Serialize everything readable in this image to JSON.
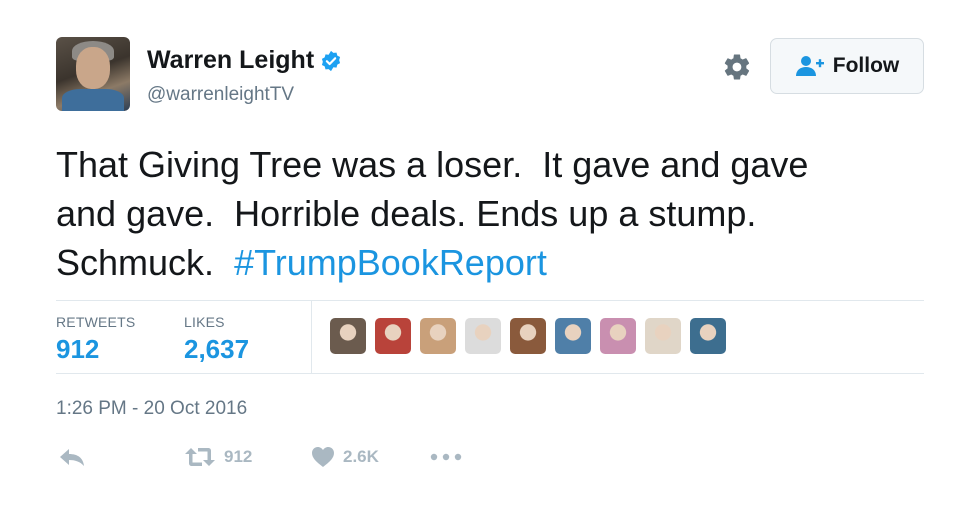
{
  "user": {
    "name": "Warren Leight",
    "handle": "@warrenleightTV",
    "verified": true
  },
  "follow_button": {
    "label": "Follow"
  },
  "tweet": {
    "lines": [
      "That Giving Tree was a loser.  It gave and gave",
      "and gave.  Horrible deals. Ends up a stump.",
      "Schmuck.  "
    ],
    "hashtag": "#TrumpBookReport"
  },
  "stats": {
    "retweets_label": "RETWEETS",
    "retweets_value": "912",
    "likes_label": "LIKES",
    "likes_value": "2,637"
  },
  "likers": [
    {
      "color": "#6b5b4e"
    },
    {
      "color": "#b9433a"
    },
    {
      "color": "#c9a07a"
    },
    {
      "color": "#dcdcdc"
    },
    {
      "color": "#8a5a3c"
    },
    {
      "color": "#4f7fa8"
    },
    {
      "color": "#c98fb0"
    },
    {
      "color": "#e0d6c8"
    },
    {
      "color": "#3d6e8f"
    }
  ],
  "timestamp": "1:26 PM - 20 Oct 2016",
  "actions": {
    "reply_icon": "reply-icon",
    "retweet_count": "912",
    "like_count": "2.6K",
    "more_icon": "more-icon"
  },
  "colors": {
    "accent": "#1b95e0",
    "muted": "#657786",
    "action_gray": "#aab8c2",
    "verified": "#1da1f2",
    "divider": "#e1e8ed"
  }
}
